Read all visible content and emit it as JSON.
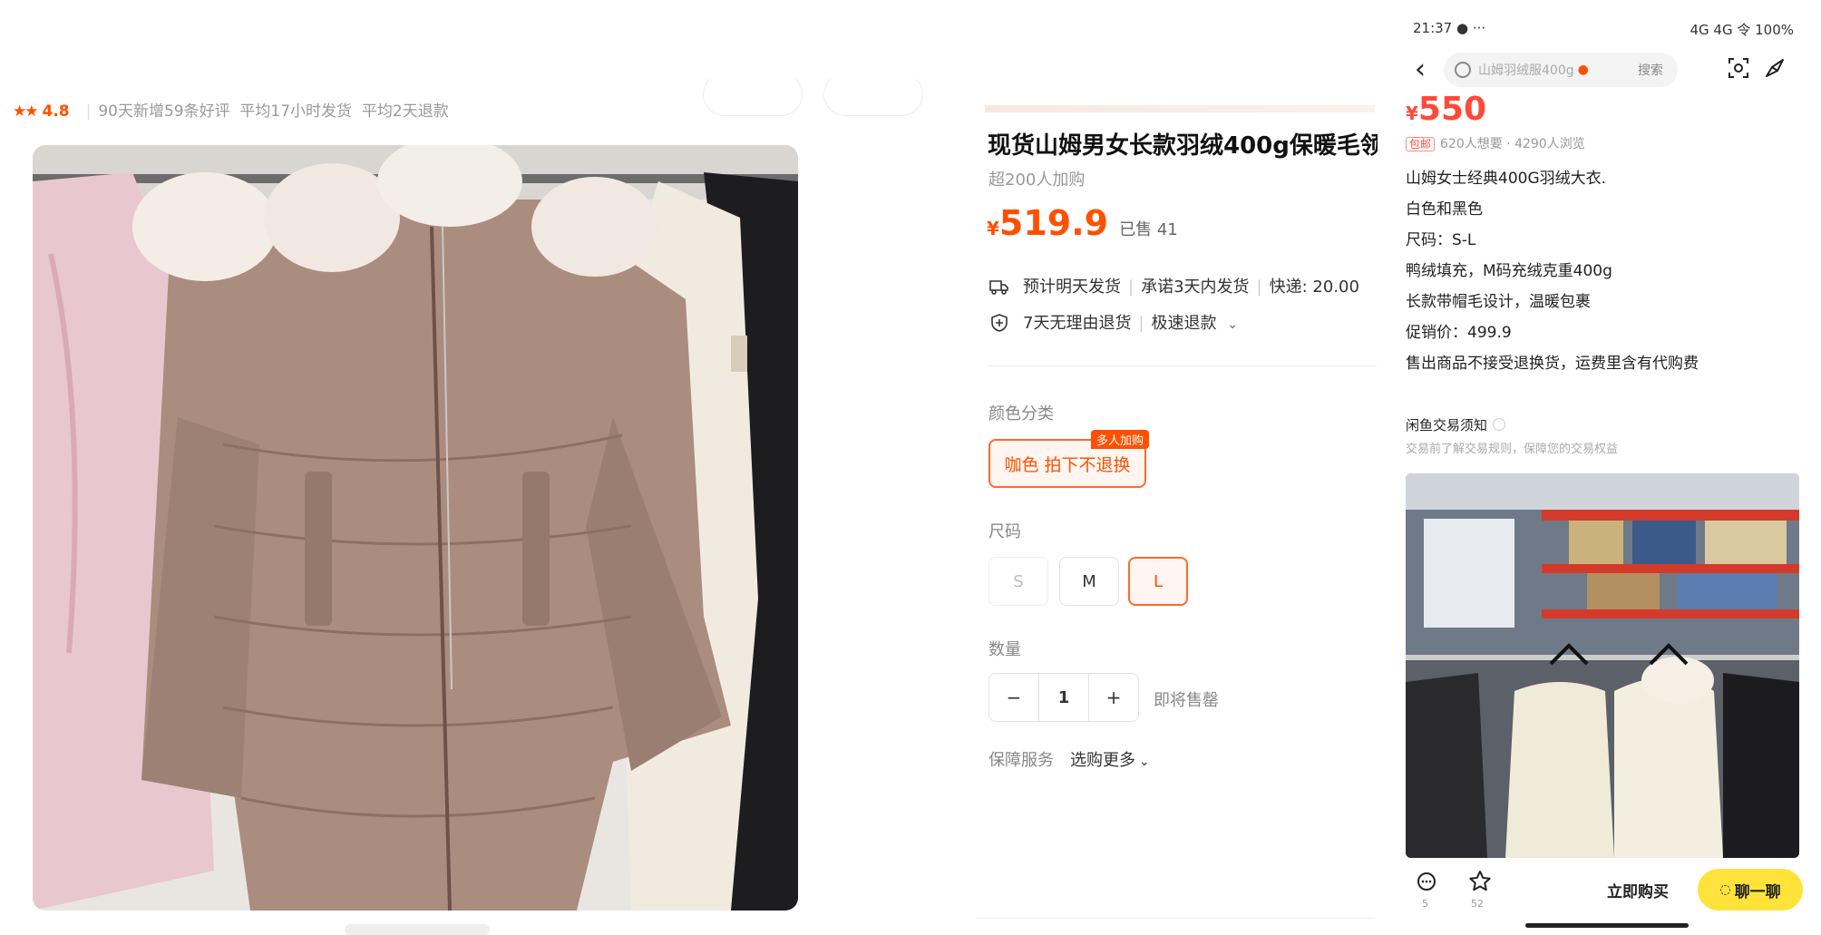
{
  "left": {
    "stars": "★★",
    "rating": "4.8",
    "stats": [
      "90天新增59条好评",
      "平均17小时发货",
      "平均2天退款"
    ]
  },
  "product": {
    "title": "现货山姆男女长款羽绒400g保暖毛领",
    "add_count": "超200人加购",
    "price_symbol": "¥",
    "price": "519.9",
    "sold": "已售 41",
    "shipping": {
      "ship": "预计明天发货",
      "promise": "承诺3天内发货",
      "fee": "快递: 20.00"
    },
    "returns": {
      "policy": "7天无理由退货",
      "refund": "极速退款"
    },
    "color": {
      "label": "颜色分类",
      "option": "咖色 拍下不退换",
      "badge": "多人加购"
    },
    "size": {
      "label": "尺码",
      "options": [
        "S",
        "M",
        "L"
      ],
      "selected": "L",
      "disabled": [
        "S"
      ]
    },
    "quantity": {
      "label": "数量",
      "minus": "−",
      "value": "1",
      "plus": "+",
      "note": "即将售罄"
    },
    "guarantee": {
      "label": "保障服务",
      "more": "选购更多"
    }
  },
  "phone": {
    "status": {
      "time": "21:37 ● ···",
      "indicators": "4G 4G 令 100%"
    },
    "search": {
      "placeholder": "山姆羽绒服400g",
      "button": "搜索"
    },
    "price_symbol": "¥",
    "price": "550",
    "meta": {
      "tag": "包邮",
      "text": "620人想要 · 4290人浏览"
    },
    "description": [
      "山姆女士经典400G羽绒大衣.",
      "白色和黑色",
      "尺码：S-L",
      "鸭绒填充，M码充绒克重400g",
      "长款带帽毛设计，温暖包裹",
      "促销价：499.9",
      "售出商品不接受退换货，运费里含有代购费"
    ],
    "notice": {
      "title": "闲鱼交易须知",
      "sub": "交易前了解交易规则，保障您的交易权益"
    },
    "bottom": {
      "chat_count": "5",
      "fav_count": "52",
      "buy": "立即购买",
      "chat": "聊一聊"
    }
  },
  "colors": {
    "accent": "#ff5000",
    "chat_yellow": "#ffe33a",
    "phone_price": "#ff4a3a"
  },
  "icons": [
    "truck-icon",
    "return-shield-icon",
    "chevron-down-icon",
    "back-icon",
    "search-icon",
    "scan-icon",
    "share-icon",
    "chat-icon",
    "star-icon"
  ]
}
